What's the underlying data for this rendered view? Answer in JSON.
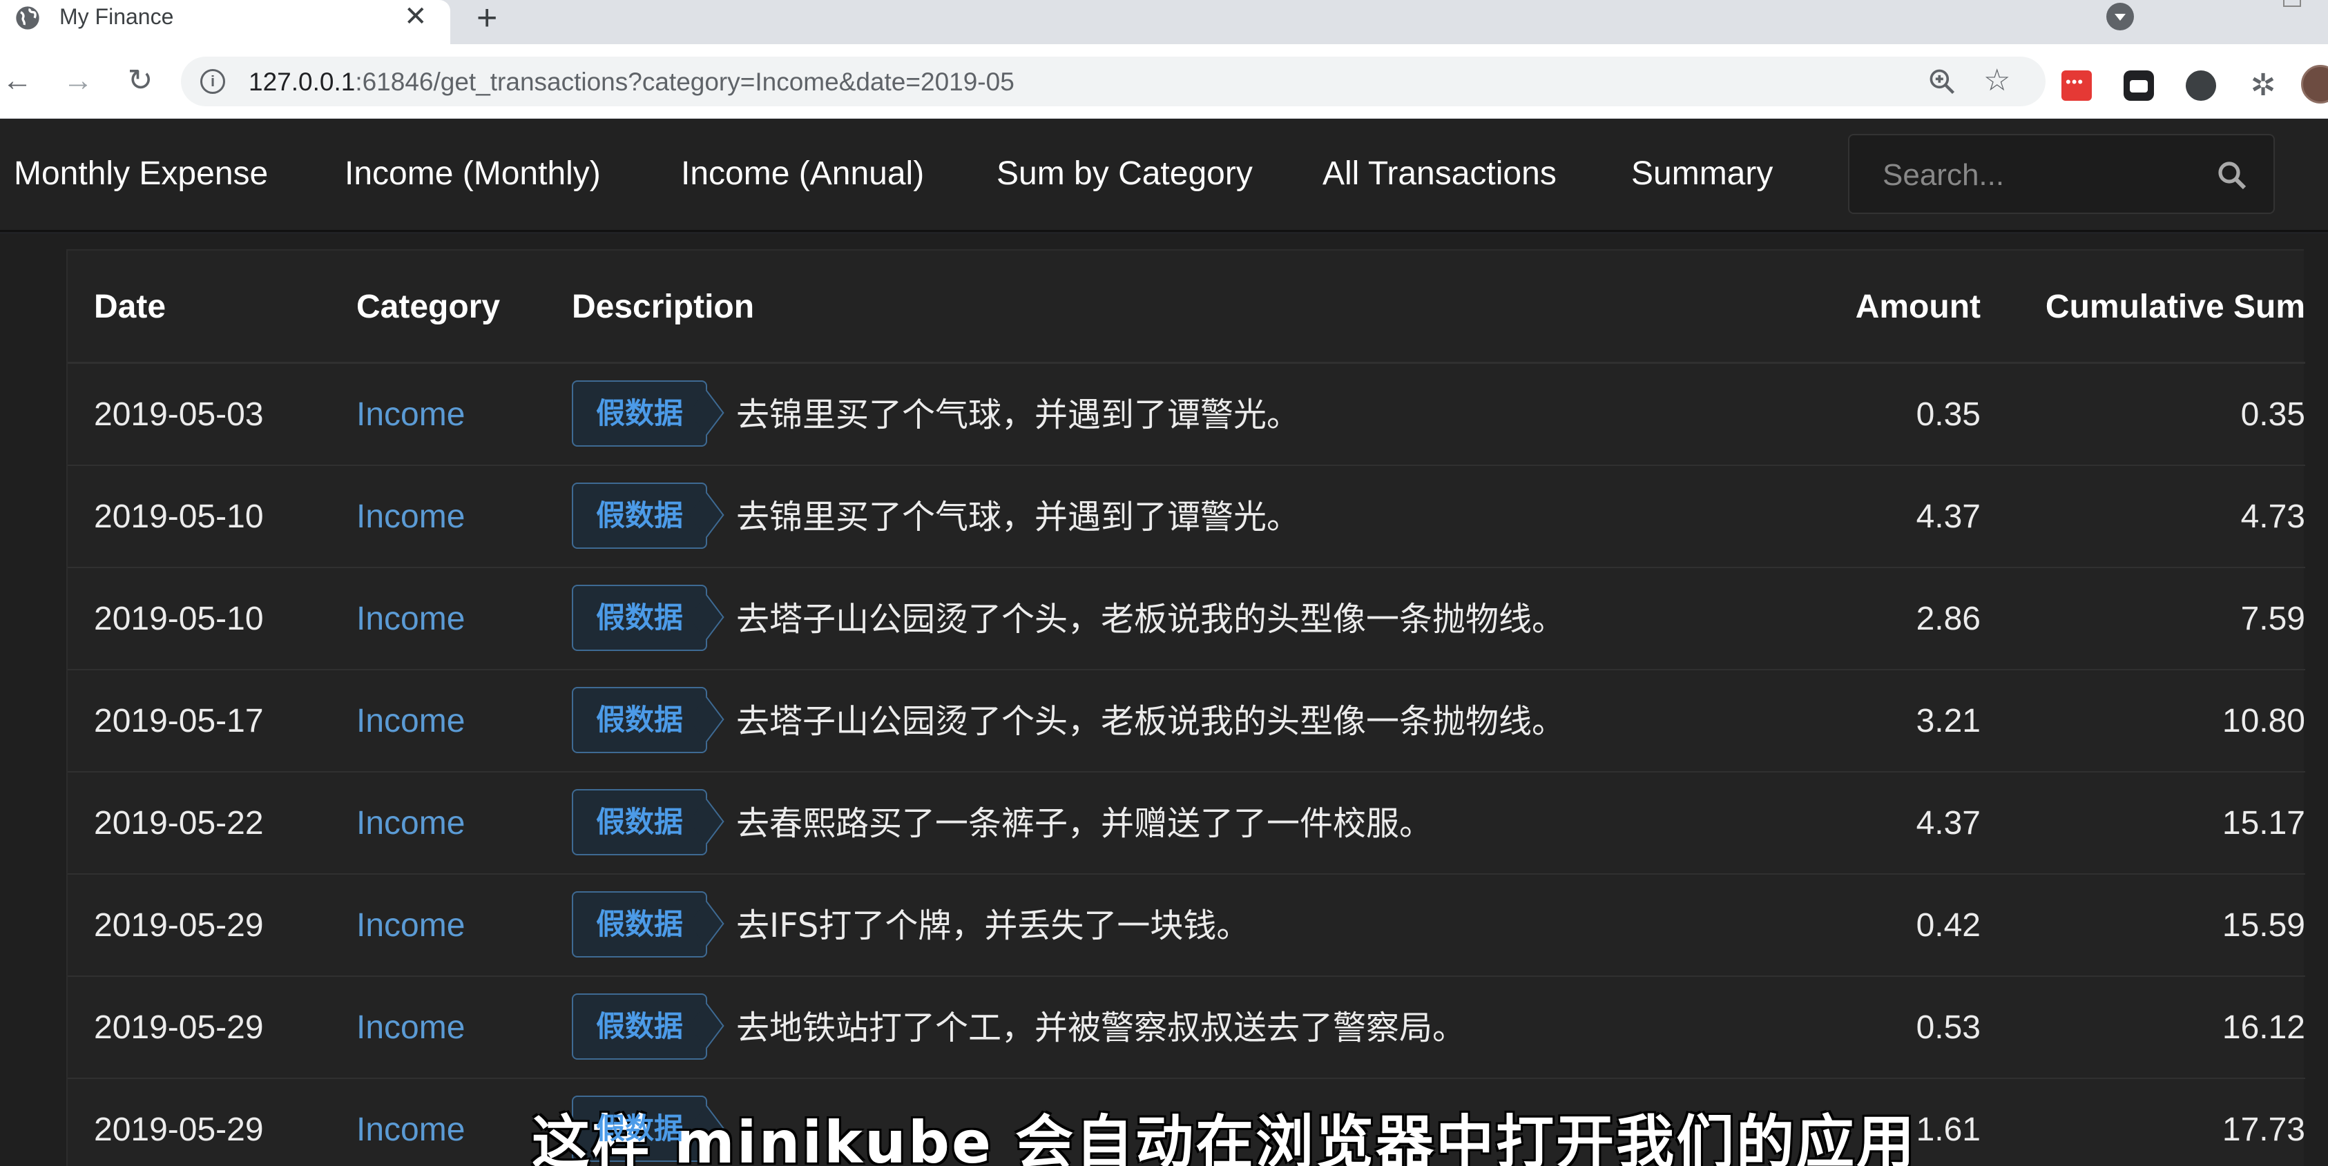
{
  "browser": {
    "tab_title": "My Finance",
    "tab_close": "✕",
    "new_tab": "+",
    "url_host": "127.0.0.1",
    "url_rest": ":61846/get_transactions?category=Income&date=2019-05",
    "back": "←",
    "forward": "→",
    "reload": "↻",
    "star": "☆",
    "puzzle": "✲"
  },
  "navbar": {
    "items": [
      {
        "label": "Monthly Expense"
      },
      {
        "label": "Income (Monthly)"
      },
      {
        "label": "Income (Annual)"
      },
      {
        "label": "Sum by Category"
      },
      {
        "label": "All Transactions"
      },
      {
        "label": "Summary"
      }
    ],
    "search_placeholder": "Search..."
  },
  "table": {
    "headers": {
      "date": "Date",
      "category": "Category",
      "description": "Description",
      "amount": "Amount",
      "cumulative": "Cumulative Sum"
    },
    "badge_label": "假数据",
    "rows": [
      {
        "date": "2019-05-03",
        "category": "Income",
        "description": "去锦里买了个气球，并遇到了谭警光。",
        "amount": "0.35",
        "cumulative": "0.35"
      },
      {
        "date": "2019-05-10",
        "category": "Income",
        "description": "去锦里买了个气球，并遇到了谭警光。",
        "amount": "4.37",
        "cumulative": "4.73"
      },
      {
        "date": "2019-05-10",
        "category": "Income",
        "description": "去塔子山公园烫了个头，老板说我的头型像一条抛物线。",
        "amount": "2.86",
        "cumulative": "7.59"
      },
      {
        "date": "2019-05-17",
        "category": "Income",
        "description": "去塔子山公园烫了个头，老板说我的头型像一条抛物线。",
        "amount": "3.21",
        "cumulative": "10.80"
      },
      {
        "date": "2019-05-22",
        "category": "Income",
        "description": "去春熙路买了一条裤子，并赠送了了一件校服。",
        "amount": "4.37",
        "cumulative": "15.17"
      },
      {
        "date": "2019-05-29",
        "category": "Income",
        "description": "去IFS打了个牌，并丢失了一块钱。",
        "amount": "0.42",
        "cumulative": "15.59"
      },
      {
        "date": "2019-05-29",
        "category": "Income",
        "description": "去地铁站打了个工，并被警察叔叔送去了警察局。",
        "amount": "0.53",
        "cumulative": "16.12"
      },
      {
        "date": "2019-05-29",
        "category": "Income",
        "description": "",
        "amount": "1.61",
        "cumulative": "17.73"
      }
    ]
  },
  "subtitle": "这样 minikube 会自动在浏览器中打开我们的应用"
}
